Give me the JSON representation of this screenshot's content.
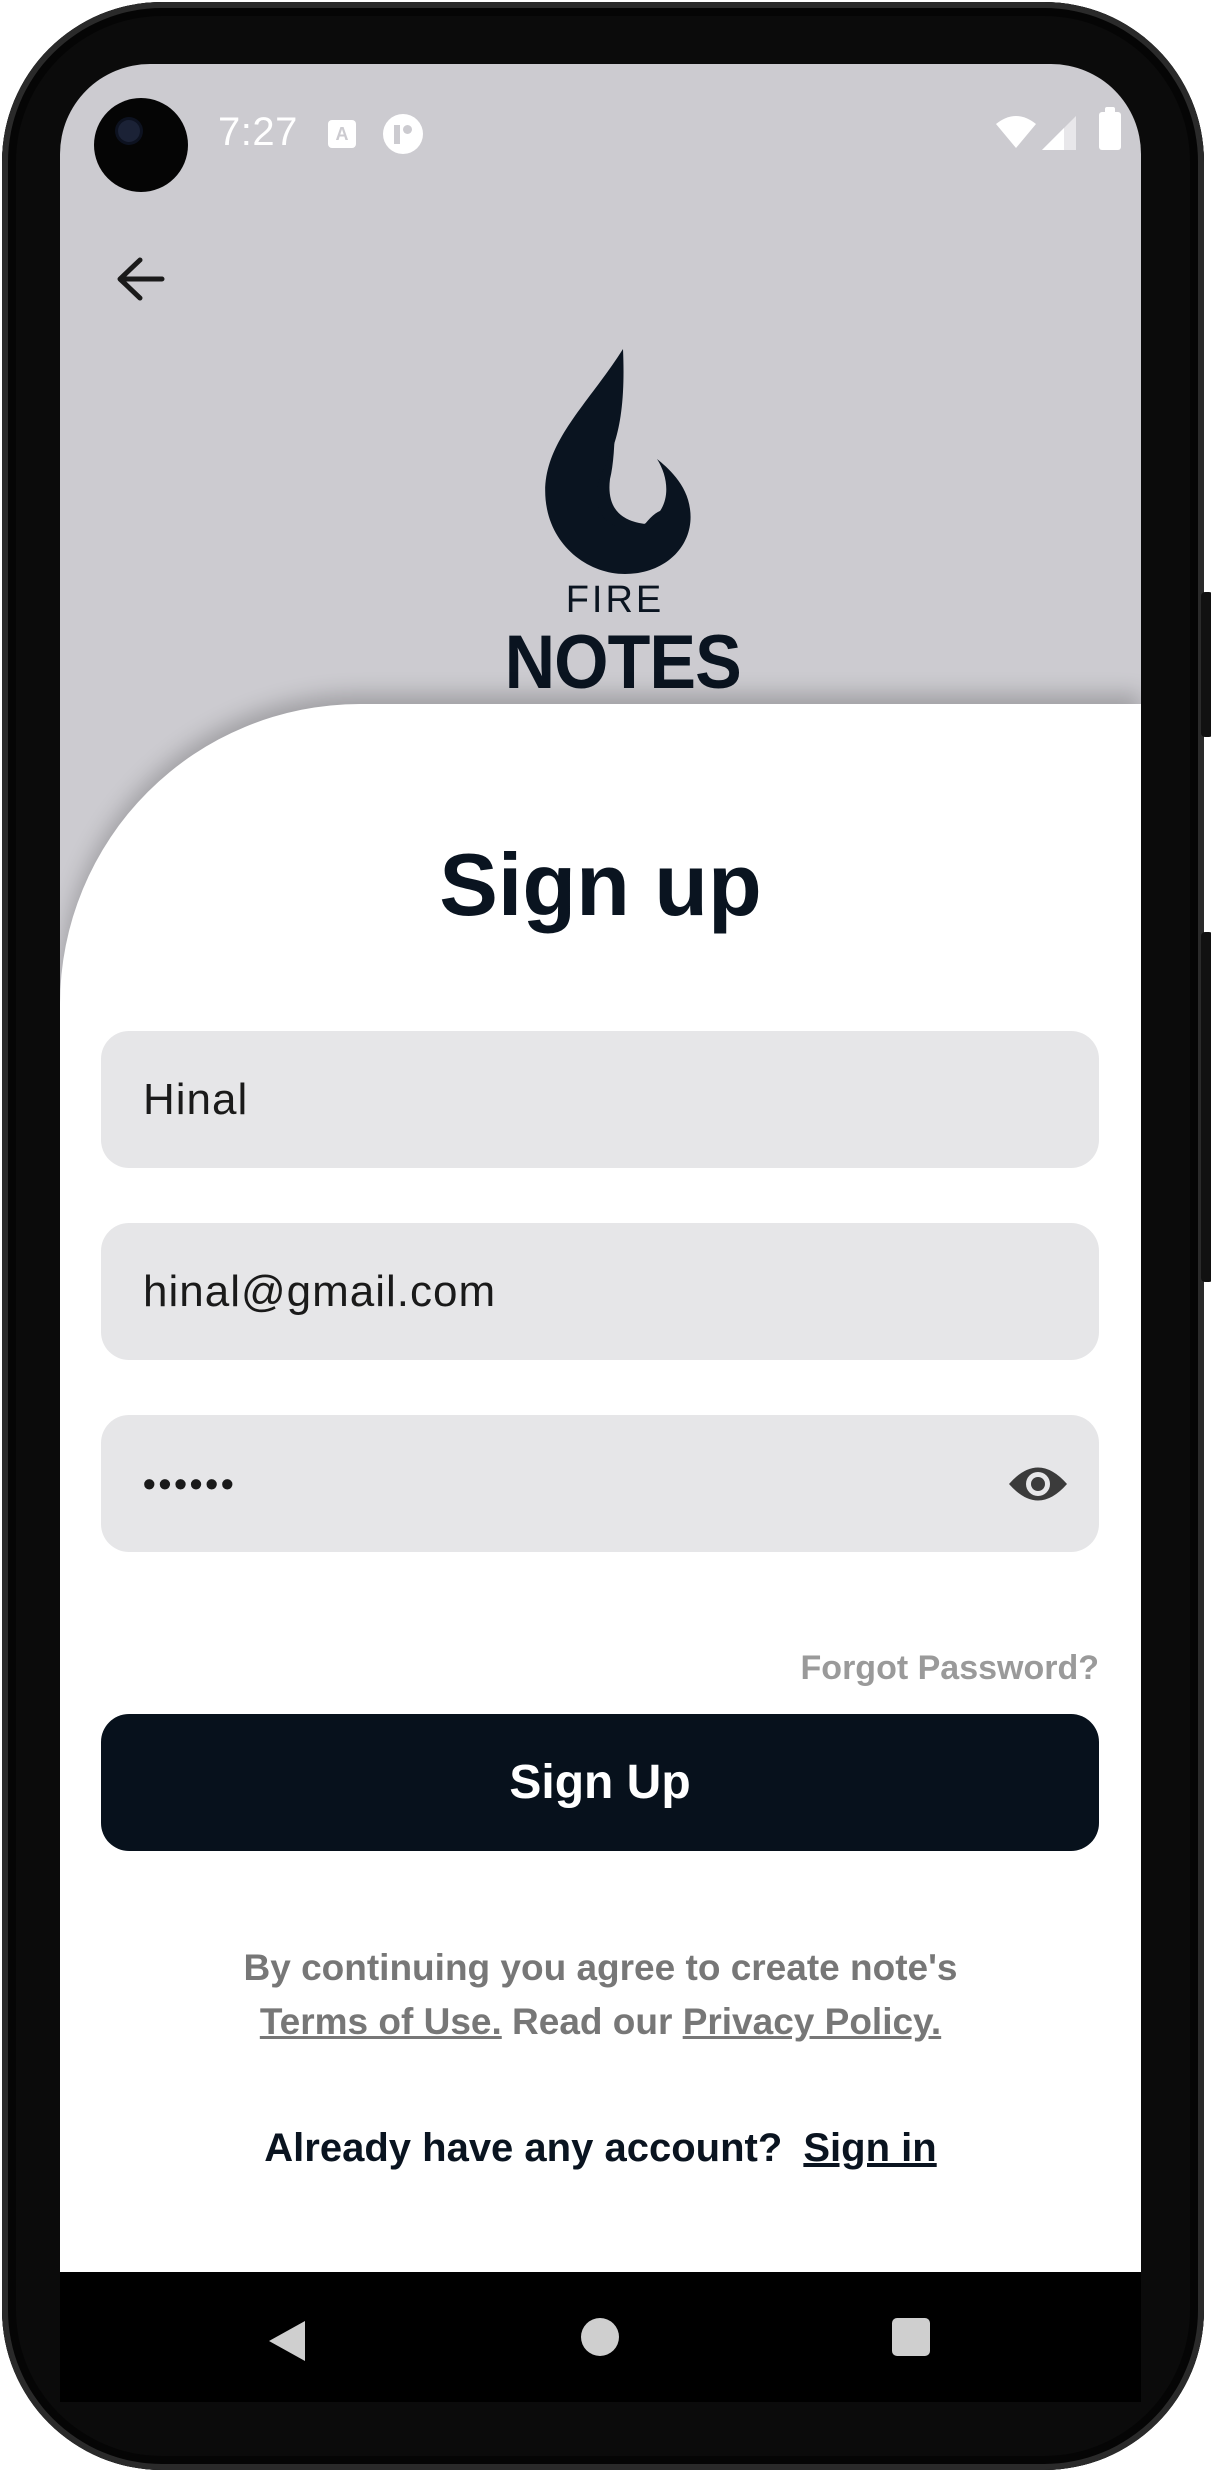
{
  "status_bar": {
    "time": "7:27",
    "icons": [
      "keyboard-icon",
      "app-notification-icon",
      "wifi-icon",
      "signal-icon",
      "battery-icon"
    ]
  },
  "header": {
    "back_icon": "arrow-left-icon"
  },
  "logo": {
    "word_small": "FIRE",
    "word_big": "NOTES",
    "color": "#0a1420"
  },
  "form": {
    "title": "Sign up",
    "name_value": "Hinal",
    "email_value": "hinal@gmail.com",
    "password_value": "••••••",
    "password_toggle_icon": "eye-icon",
    "forgot_label": "Forgot Password?",
    "submit_label": "Sign Up"
  },
  "terms": {
    "line1": "By continuing you agree to create note's",
    "terms_link": "Terms of Use.",
    "middle": "Read our",
    "privacy_link": "Privacy Policy."
  },
  "signin": {
    "prompt": "Already have any account?",
    "link": "Sign in"
  },
  "colors": {
    "header_bg": "#cccbd0",
    "primary": "#07111c",
    "field_bg": "#e6e6e8",
    "muted_text": "#777777"
  }
}
